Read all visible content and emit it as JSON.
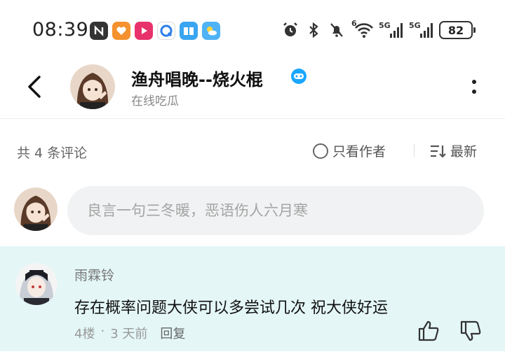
{
  "status_bar": {
    "time": "08:39",
    "battery": "82",
    "network_1": "5G",
    "network_2": "5G",
    "wifi_label": "6",
    "app_icons": [
      "nfc-icon",
      "health-icon",
      "video-app-icon",
      "browser-icon",
      "reader-icon",
      "weather-icon"
    ],
    "system_icons": [
      "alarm-icon",
      "bluetooth-icon",
      "mute-icon",
      "wifi-icon"
    ]
  },
  "header": {
    "user_name": "渔舟唱晚--烧火棍",
    "status": "在线吃瓜",
    "badge_color": "#1aa7ff"
  },
  "comments_bar": {
    "count_text": "共 4 条评论",
    "author_only": "只看作者",
    "sort": "最新"
  },
  "input": {
    "placeholder": "良言一句三冬暖，恶语伤人六月寒"
  },
  "comment": {
    "author": "雨霖铃",
    "text": "存在概率问题大侠可以多尝试几次 祝大侠好运",
    "floor": "4楼",
    "separator": "·",
    "time": "3 天前",
    "reply": "回复",
    "highlight_color": "#e4f6f6"
  }
}
